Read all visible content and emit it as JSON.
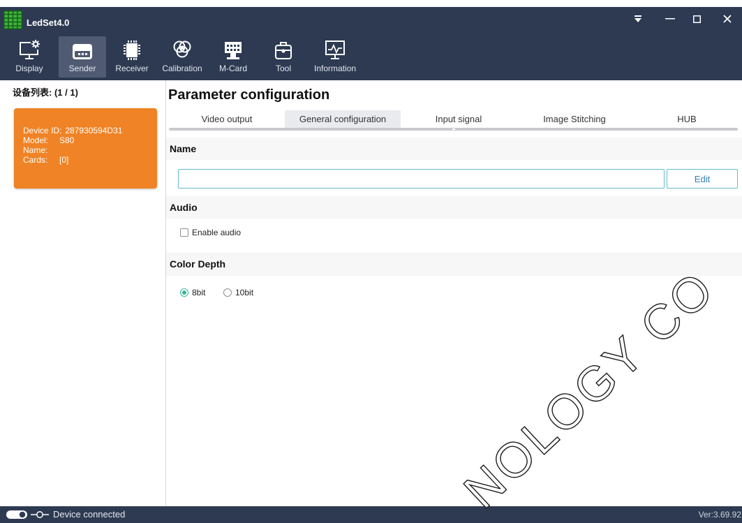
{
  "app": {
    "title": "LedSet4.0",
    "logo_icon": "led-panel-icon"
  },
  "colors": {
    "nav": "#2d3a52",
    "nav_active": "#505b73",
    "orange": "#ef8325",
    "teal": "#36b49d",
    "input_border": "#64bccf",
    "link": "#2f7fb8",
    "tab_active": "#e9ebee",
    "band": "#f7f7f8"
  },
  "window_controls": {
    "icons": [
      "dropdown-icon",
      "minimize-icon",
      "maximize-icon",
      "close-icon"
    ]
  },
  "toolbar": {
    "items": [
      {
        "label": "Display",
        "icon": "display-icon"
      },
      {
        "label": "Sender",
        "icon": "sender-icon"
      },
      {
        "label": "Receiver",
        "icon": "receiver-icon"
      },
      {
        "label": "Calibration",
        "icon": "calibration-icon"
      },
      {
        "label": "M-Card",
        "icon": "m-card-icon"
      },
      {
        "label": "Tool",
        "icon": "tool-icon"
      },
      {
        "label": "Information",
        "icon": "information-icon"
      }
    ],
    "active_index": 1
  },
  "sidebar": {
    "title": "设备列表: (1 / 1)",
    "devices": [
      {
        "device_id_label": "Device ID:",
        "device_id": "287930594D31",
        "model_label": "Model:",
        "model": "S80",
        "name_label": "Name:",
        "name": "",
        "cards_label": "Cards:",
        "cards": "[0]",
        "selected": true
      }
    ]
  },
  "main": {
    "title": "Parameter configuration",
    "tabs": [
      "Video output",
      "General configuration",
      "Input signal",
      "Image Stitching",
      "HUB"
    ],
    "active_tab_index": 1,
    "name_section": {
      "heading": "Name",
      "value": "",
      "edit_label": "Edit"
    },
    "audio_section": {
      "heading": "Audio",
      "enable_label": "Enable audio",
      "enabled": false
    },
    "color_depth_section": {
      "heading": "Color Depth",
      "options": [
        "8bit",
        "10bit"
      ],
      "selected_index": 0
    }
  },
  "status_bar": {
    "connection_icon": "toggle-icon",
    "plug_icon": "plug-icon",
    "status": "Device connected",
    "version": "Ver:3.69.92"
  },
  "watermark": {
    "text": "NOLOGY CO"
  }
}
